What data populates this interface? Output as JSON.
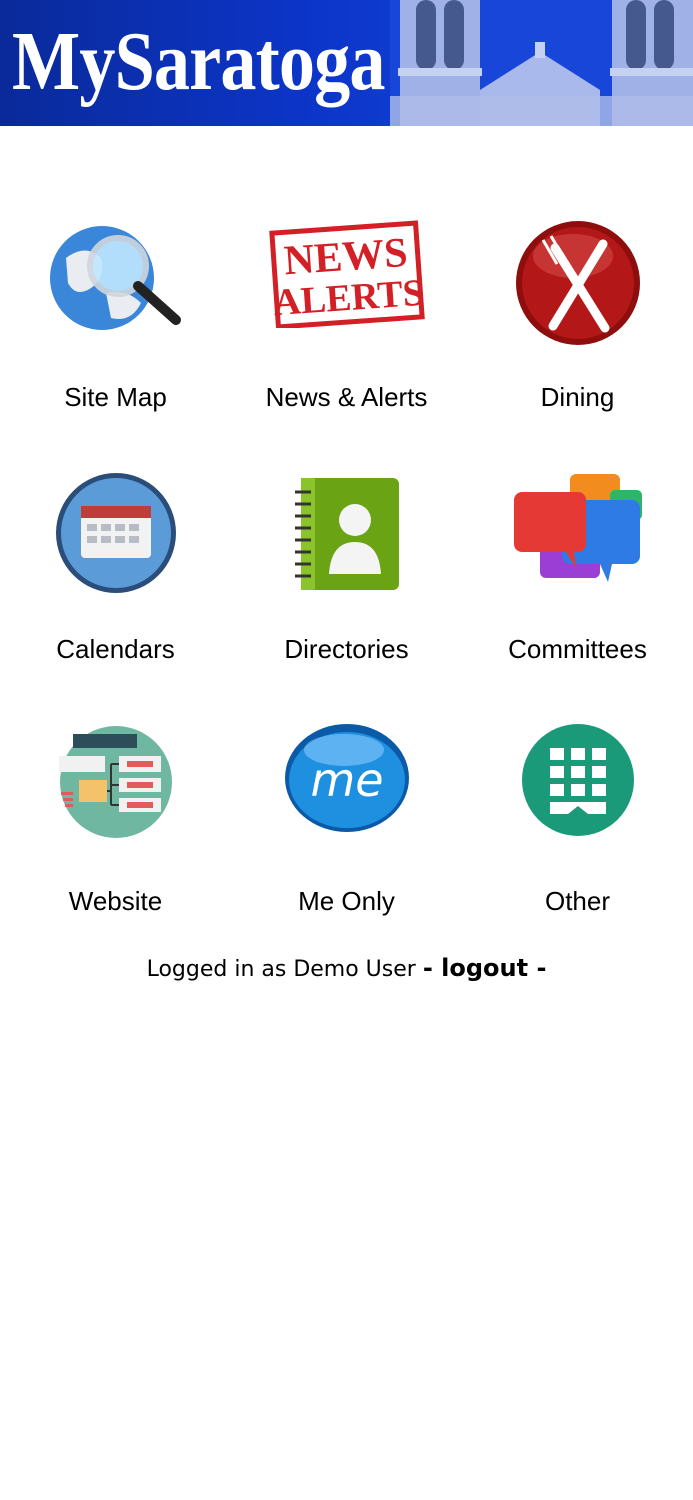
{
  "banner": {
    "title": "MySaratoga",
    "art": "church-towers"
  },
  "menu": {
    "items": [
      {
        "label": "Site Map",
        "icon": "globe-magnifier-icon"
      },
      {
        "label": "News & Alerts",
        "icon": "news-alerts-stamp-icon"
      },
      {
        "label": "Dining",
        "icon": "fork-knife-icon"
      },
      {
        "label": "Calendars",
        "icon": "calendar-icon"
      },
      {
        "label": "Directories",
        "icon": "address-book-icon"
      },
      {
        "label": "Committees",
        "icon": "chat-bubbles-icon"
      },
      {
        "label": "Website",
        "icon": "sitemap-icon"
      },
      {
        "label": "Me Only",
        "icon": "me-bubble-icon"
      },
      {
        "label": "Other",
        "icon": "app-grid-icon"
      }
    ]
  },
  "footer": {
    "logged_in_text": "Logged in as Demo User",
    "logout_label": "- logout -"
  },
  "colors": {
    "banner": "#0c35c9",
    "text": "#000000",
    "background": "#ffffff"
  }
}
